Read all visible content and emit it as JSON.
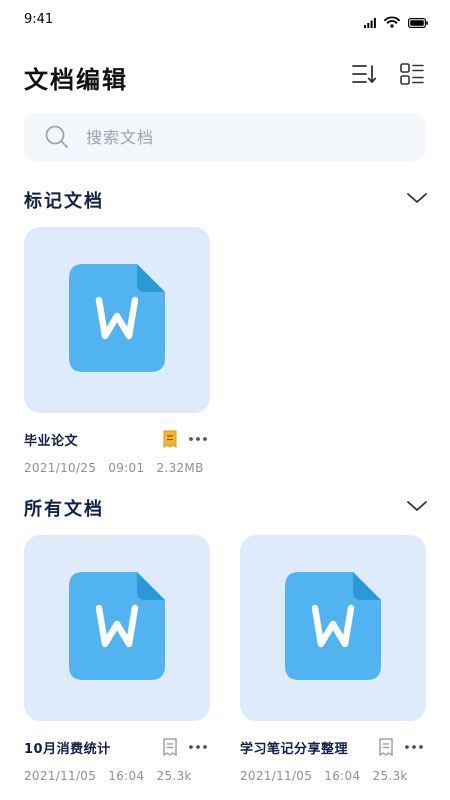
{
  "status_bar": {
    "time": "9:41"
  },
  "header": {
    "title": "文档编辑",
    "sort_icon": "sort-descending-icon",
    "view_icon": "grid-list-view-icon"
  },
  "search": {
    "placeholder": "搜索文档",
    "value": ""
  },
  "sections": {
    "marked": {
      "title": "标记文档",
      "files": [
        {
          "name": "毕业论文",
          "date": "2021/10/25",
          "time": "09:01",
          "size": "2.32MB",
          "bookmarked": true
        }
      ]
    },
    "all": {
      "title": "所有文档",
      "files": [
        {
          "name": "10月消费统计",
          "date": "2021/11/05",
          "time": "16:04",
          "size": "25.3k",
          "bookmarked": false
        },
        {
          "name": "学习笔记分享整理",
          "date": "2021/11/05",
          "time": "16:04",
          "size": "25.3k",
          "bookmarked": false
        }
      ]
    }
  },
  "colors": {
    "doc_icon": "#52b3f1",
    "doc_fold": "#2b98d8",
    "thumb_bg": "#ddebfb",
    "bookmark_active": "#f3b731",
    "bookmark_inactive": "#8f959e",
    "search_bg": "#f3f7fc",
    "title_text": "#10204a"
  }
}
